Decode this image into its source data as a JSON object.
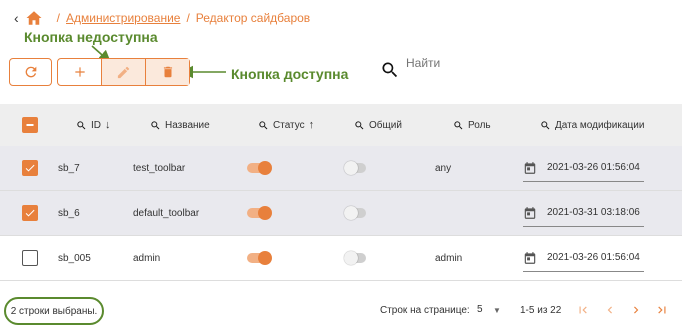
{
  "breadcrumb": {
    "items": [
      "Администрирование",
      "Редактор сайдбаров"
    ],
    "separator": "/"
  },
  "annotations": {
    "unavailable": "Кнопка недоступна",
    "available": "Кнопка доступна"
  },
  "search": {
    "placeholder": "Найти"
  },
  "table": {
    "columns": [
      "ID",
      "Название",
      "Статус",
      "Общий",
      "Роль",
      "Дата модификации"
    ],
    "rows": [
      {
        "id": "sb_7",
        "name": "test_toolbar",
        "status": true,
        "shared": false,
        "role": "any",
        "date": "2021-03-26 01:56:04",
        "selected": true
      },
      {
        "id": "sb_6",
        "name": "default_toolbar",
        "status": true,
        "shared": false,
        "role": "",
        "date": "2021-03-31 03:18:06",
        "selected": true
      },
      {
        "id": "sb_005",
        "name": "admin",
        "status": true,
        "shared": false,
        "role": "admin",
        "date": "2021-03-26 01:56:04",
        "selected": false
      }
    ]
  },
  "footer": {
    "selected": "2 строки выбраны.",
    "rows_per_page_label": "Строк на странице:",
    "rows_per_page": "5",
    "range": "1-5 из 22"
  },
  "colors": {
    "accent": "#e8803c",
    "annotation": "#5a8a2e"
  }
}
